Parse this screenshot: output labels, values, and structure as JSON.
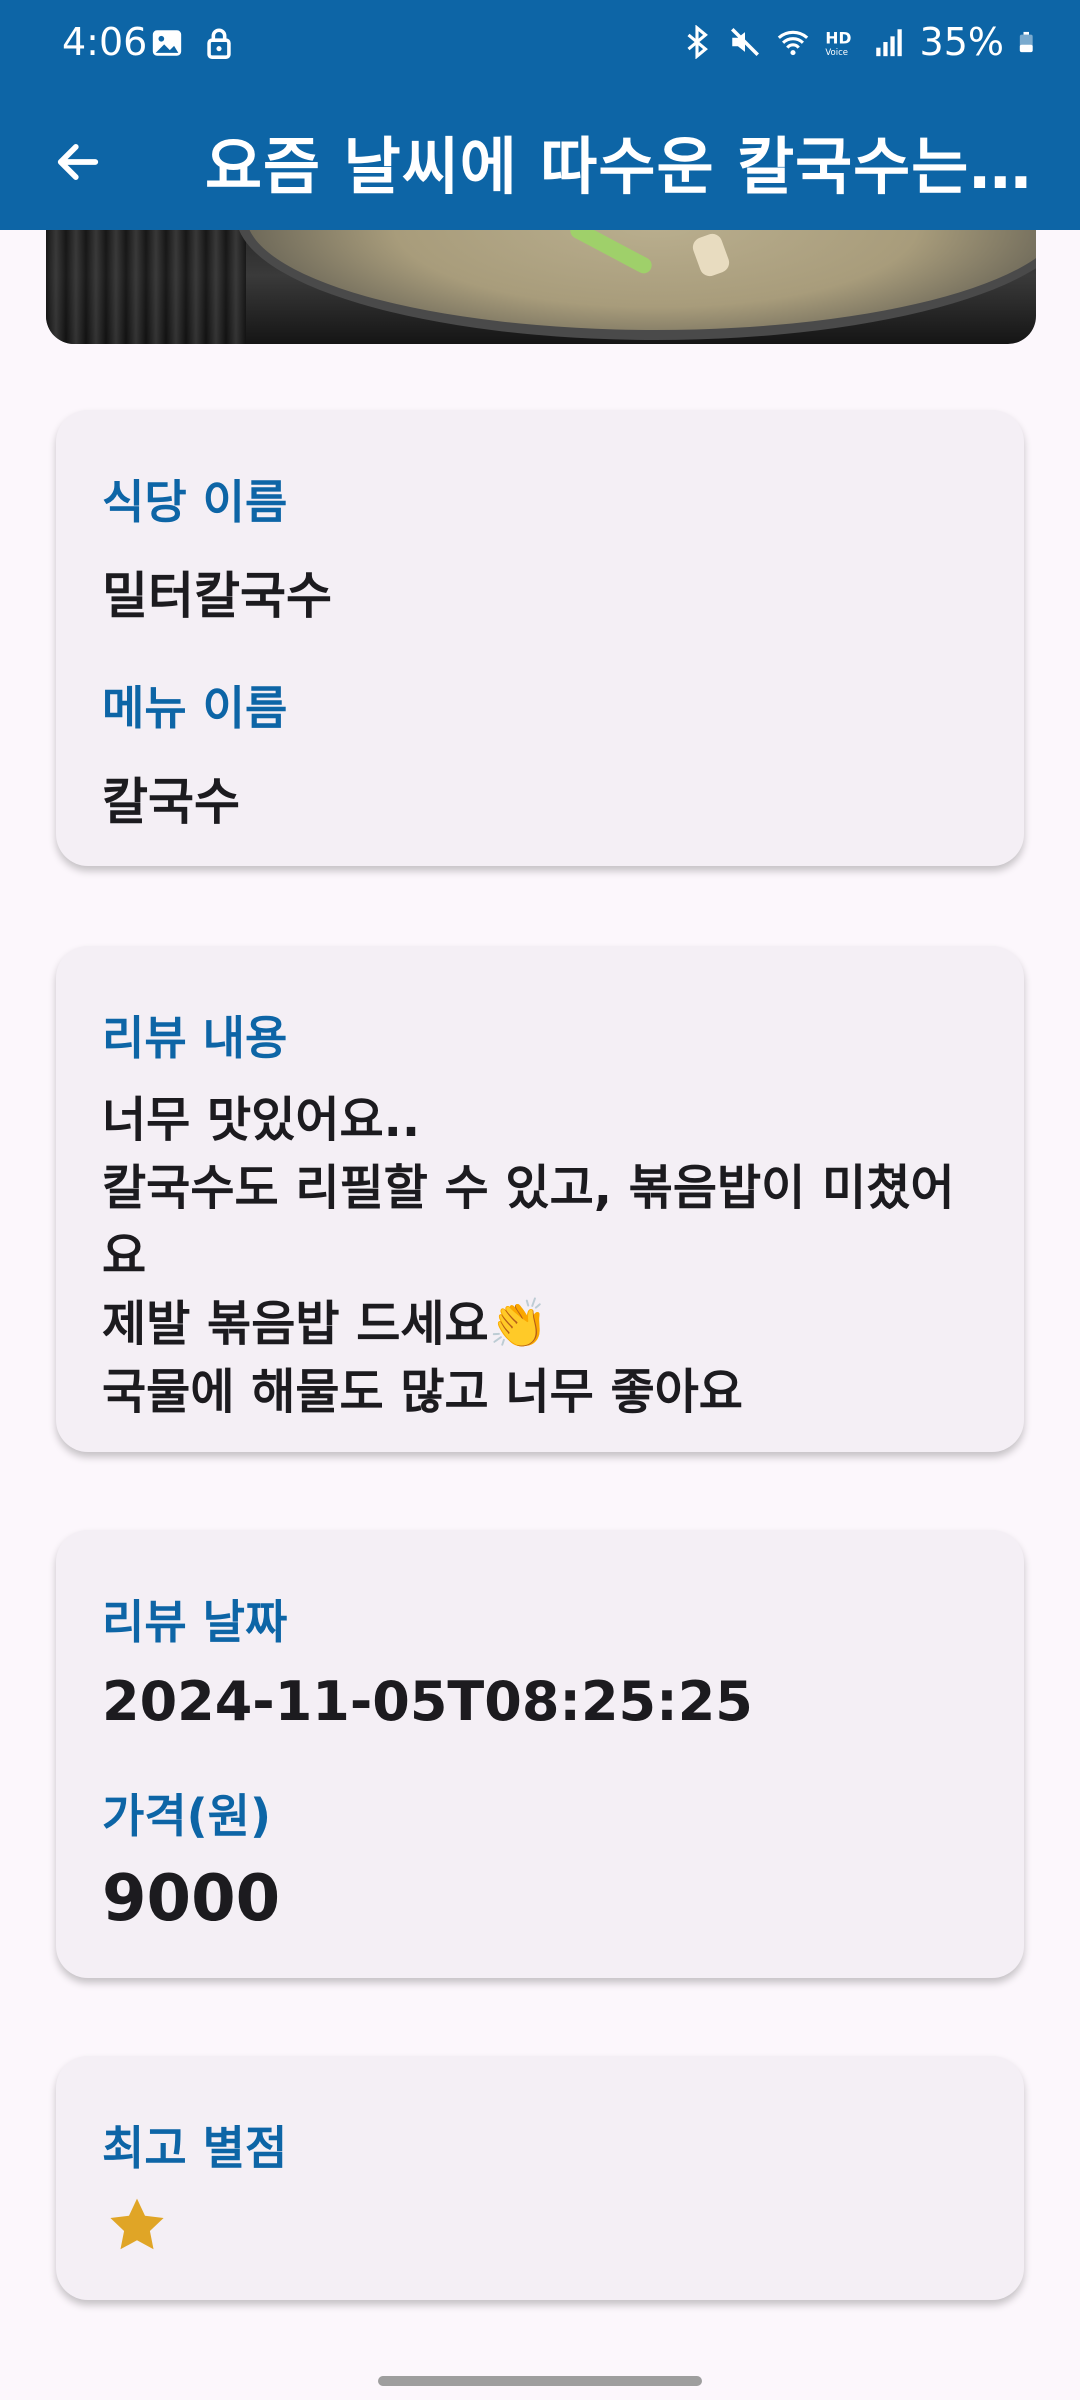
{
  "status_bar": {
    "time": "4:06",
    "battery": "35%",
    "icons": [
      "image-icon",
      "lock-icon",
      "bluetooth-icon",
      "mute-icon",
      "wifi-icon",
      "hd-voice-icon",
      "signal-icon",
      "battery-icon"
    ]
  },
  "app_bar": {
    "title": "요즘 날씨에 따수운 칼국수는 여…",
    "back_icon": "arrow-left-icon"
  },
  "restaurant_card": {
    "restaurant_label": "식당 이름",
    "restaurant_value": "밀터칼국수",
    "menu_label": "메뉴 이름",
    "menu_value": "칼국수"
  },
  "review_card": {
    "label": "리뷰 내용",
    "content": "너무 맛있어요..\n칼국수도 리필할 수 있고, 볶음밥이 미쳤어요\n제발 볶음밥 드세요👏\n국물에 해물도 많고 너무 좋아요"
  },
  "date_card": {
    "date_label": "리뷰 날짜",
    "date_value": "2024-11-05T08:25:25",
    "price_label": "가격(원)",
    "price_value": "9000"
  },
  "rating_card": {
    "label": "최고 별점",
    "stars": 1,
    "star_icon": "star-icon",
    "star_color": "#e0a526"
  },
  "colors": {
    "primary": "#0d65a6",
    "background": "#fcf7fc",
    "card": "#f4eff5"
  }
}
